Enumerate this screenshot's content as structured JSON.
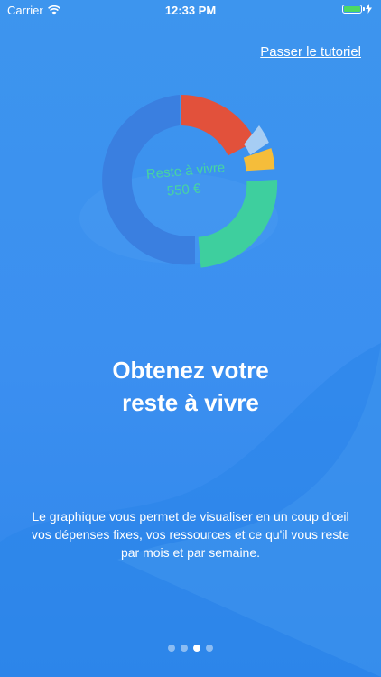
{
  "status_bar": {
    "carrier": "Carrier",
    "time": "12:33 PM",
    "battery_color": "#4cd964"
  },
  "onboarding": {
    "skip_label": "Passer le tutoriel",
    "chart_center_label": "Reste à vivre",
    "chart_center_value": "550 €",
    "headline_line1": "Obtenez votre",
    "headline_line2": "reste à vivre",
    "description": "Le graphique vous permet de visualiser en un coup d'œil vos dépenses fixes, vos ressources et ce qu'il vous reste par mois et par semaine.",
    "page_count": 4,
    "active_page_index": 2
  },
  "colors": {
    "background": "#3b8ff0",
    "ring_base": "#3a7fe0",
    "ring_red": "#e2513b",
    "ring_light_blue": "#a6cdf4",
    "ring_yellow": "#f5bd3a",
    "ring_green": "#3ecf9e",
    "center_text": "#47d4a1"
  }
}
